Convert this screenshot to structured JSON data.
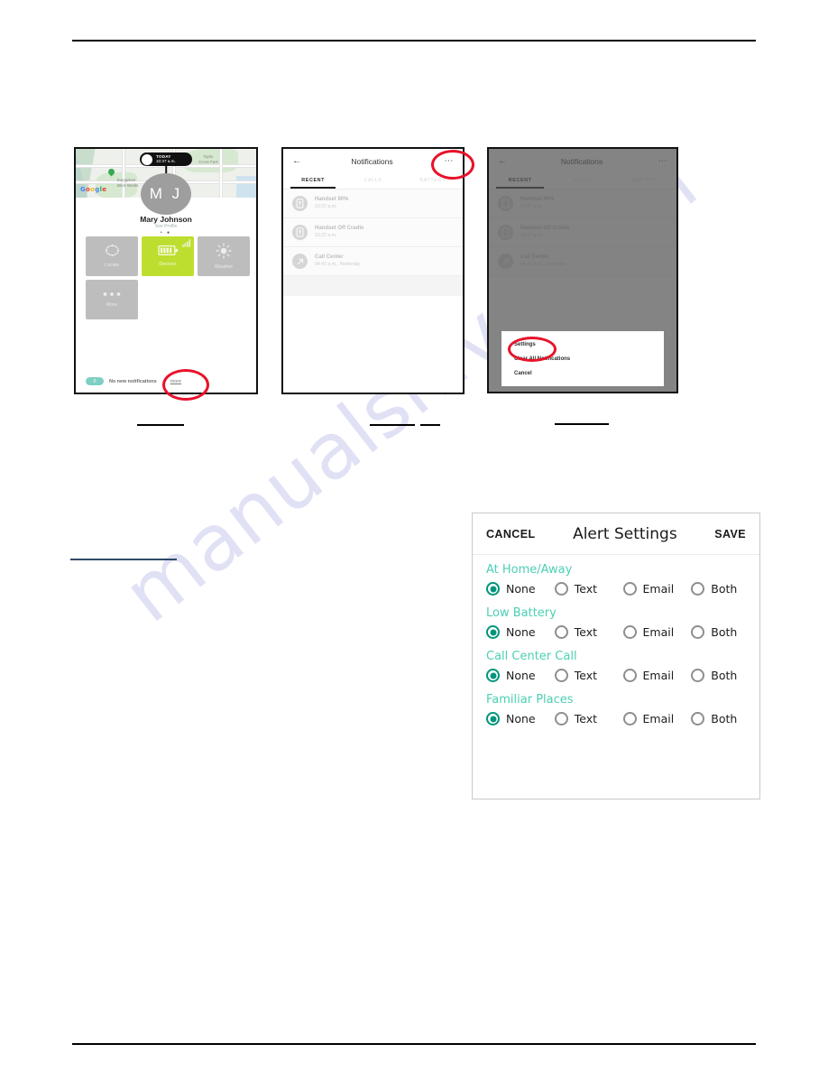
{
  "document": {
    "watermark": "manualshive.com"
  },
  "phone_home": {
    "map": {
      "today_label": "TODAY",
      "today_time": "10:37 a.m.",
      "labels": [
        "Taylor",
        "Creek Park",
        "Evergreen",
        "Brick Works"
      ],
      "google_logo": [
        "G",
        "o",
        "o",
        "g",
        "l",
        "e"
      ]
    },
    "avatar_initials": "M J",
    "user_name": "Mary Johnson",
    "see_profile": "See Profile",
    "page_dots": "• ●",
    "tiles": [
      {
        "label": "Locate",
        "icon": "locate-icon",
        "accent": false
      },
      {
        "label": "Devices",
        "icon": "battery-icon",
        "accent": true
      },
      {
        "label": "Weather",
        "icon": "sun-icon",
        "accent": false
      },
      {
        "label": "More",
        "icon": "ellipsis-icon",
        "accent": false
      }
    ],
    "bottom_bar": {
      "badge": "0",
      "status": "No new notifications",
      "more_link": "more"
    }
  },
  "phone_notifications": {
    "title": "Notifications",
    "back_icon": "arrow-left-icon",
    "kebab_icon": "overflow-menu-icon",
    "tabs": [
      {
        "label": "RECENT",
        "active": true
      },
      {
        "label": "CALLS",
        "active": false
      },
      {
        "label": "BATTERY",
        "active": false
      }
    ],
    "items": [
      {
        "title": "Handset 90%",
        "time": "10:37 a.m.",
        "icon": "handset-icon"
      },
      {
        "title": "Handset Off Cradle",
        "time": "10:37 a.m.",
        "icon": "handset-icon"
      },
      {
        "title": "Call Center",
        "time": "04:47 p.m., Yesterday",
        "icon": "call-arrow-icon"
      }
    ]
  },
  "phone_menu": {
    "title": "Notifications",
    "tabs": [
      {
        "label": "RECENT",
        "active": true
      },
      {
        "label": "CALLS",
        "active": false
      },
      {
        "label": "BATTERY",
        "active": false
      }
    ],
    "items": [
      {
        "title": "Handset 90%",
        "time": "10:37 a.m."
      },
      {
        "title": "Handset Off Cradle",
        "time": "10:37 a.m."
      },
      {
        "title": "Call Center",
        "time": "04:47 p.m., Yesterday"
      }
    ],
    "action_sheet": [
      "Settings",
      "Clear All Notifications",
      "Cancel"
    ]
  },
  "alert_settings": {
    "cancel_label": "CANCEL",
    "title": "Alert Settings",
    "save_label": "SAVE",
    "accent_heading_color": "#4ccfb4",
    "accent_radio_color": "#00957a",
    "groups": [
      {
        "title": "At Home/Away",
        "options": [
          {
            "label": "None",
            "selected": true
          },
          {
            "label": "Text",
            "selected": false
          },
          {
            "label": "Email",
            "selected": false
          },
          {
            "label": "Both",
            "selected": false
          }
        ]
      },
      {
        "title": "Low Battery",
        "options": [
          {
            "label": "None",
            "selected": true
          },
          {
            "label": "Text",
            "selected": false
          },
          {
            "label": "Email",
            "selected": false
          },
          {
            "label": "Both",
            "selected": false
          }
        ]
      },
      {
        "title": "Call Center Call",
        "options": [
          {
            "label": "None",
            "selected": true
          },
          {
            "label": "Text",
            "selected": false
          },
          {
            "label": "Email",
            "selected": false
          },
          {
            "label": "Both",
            "selected": false
          }
        ]
      },
      {
        "title": "Familiar Places",
        "options": [
          {
            "label": "None",
            "selected": true
          },
          {
            "label": "Text",
            "selected": false
          },
          {
            "label": "Email",
            "selected": false
          },
          {
            "label": "Both",
            "selected": false
          }
        ]
      }
    ]
  }
}
